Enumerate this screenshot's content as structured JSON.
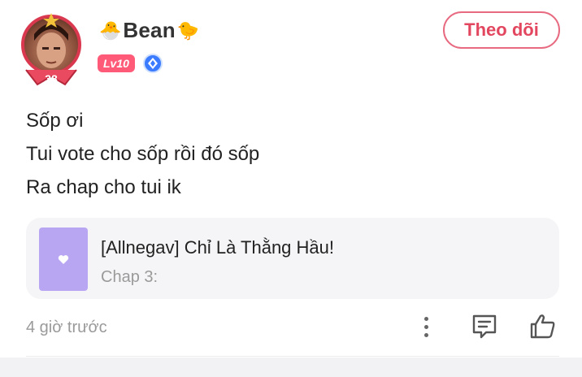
{
  "user": {
    "name": "Bean",
    "prefix_emoji": "🐣",
    "suffix_emoji": "🐤",
    "level": "Lv10",
    "avatar_number": "38"
  },
  "follow_button": {
    "label": "Theo dõi"
  },
  "comment": {
    "lines": [
      "Sốp ơi",
      "Tui vote cho sốp rồi đó sốp",
      "Ra chap cho tui ik"
    ]
  },
  "linked_story": {
    "title": "[Allnegav] Chỉ Là Thằng Hầu!",
    "chapter": "Chap 3:"
  },
  "meta": {
    "timestamp": "4 giờ trước"
  },
  "colors": {
    "accent": "#e2475f",
    "level_badge": "#ff5a77",
    "thumbnail": "#b8a6f3"
  },
  "icons": [
    "more-vertical-icon",
    "reply-icon",
    "thumbs-up-icon",
    "heart-icon",
    "verified-icon"
  ]
}
